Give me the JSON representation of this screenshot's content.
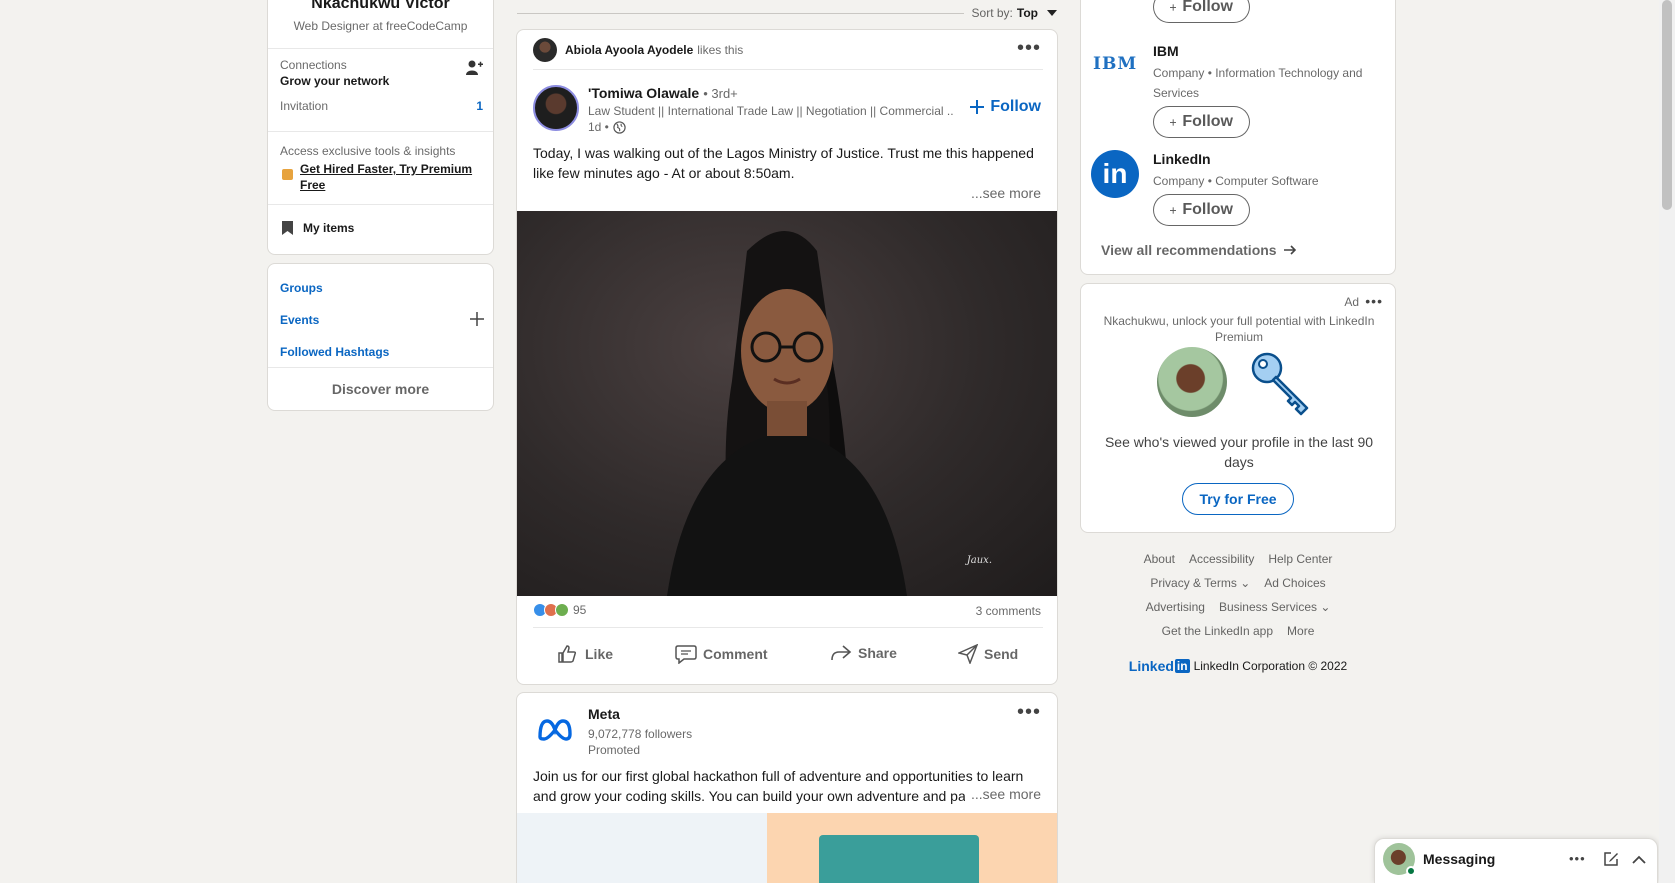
{
  "left": {
    "profile": {
      "name": "Nkachukwu Victor",
      "headline": "Web Designer at freeCodeCamp"
    },
    "connections": {
      "label": "Connections",
      "sub": "Grow your network"
    },
    "invitation": {
      "label": "Invitation",
      "count": "1"
    },
    "premium": {
      "teaser": "Access exclusive tools & insights",
      "link": "Get Hired Faster, Try Premium Free"
    },
    "my_items": "My items",
    "links": {
      "groups": "Groups",
      "events": "Events",
      "hashtags": "Followed Hashtags"
    },
    "discover": "Discover more"
  },
  "feed": {
    "sort_label": "Sort by:",
    "sort_value": "Top",
    "post1": {
      "liker": "Abiola Ayoola Ayodele",
      "likes_this": "likes this",
      "author": "'Tomiwa Olawale",
      "degree": "• 3rd+",
      "headline": "Law Student || International Trade Law || Negotiation || Commercial ...",
      "time": "1d •",
      "follow": "Follow",
      "text": "Today, I was walking out of the Lagos Ministry of Justice. Trust me this happened like few minutes ago - At or about 8:50am.",
      "see_more": "...see more",
      "watermark": "Jaux.",
      "reactions_count": "95",
      "comments": "3 comments",
      "actions": {
        "like": "Like",
        "comment": "Comment",
        "share": "Share",
        "send": "Send"
      }
    },
    "post2": {
      "company": "Meta",
      "followers": "9,072,778 followers",
      "promoted": "Promoted",
      "text": "Join us for our first global hackathon full of adventure and opportunities to learn and grow your coding skills. You can build your own adventure and pa",
      "see_more": "...see more"
    }
  },
  "right": {
    "follow_label": "Follow",
    "recs": [
      {
        "name": "IBM",
        "desc": "Company • Information Technology and Services"
      },
      {
        "name": "LinkedIn",
        "desc": "Company • Computer Software"
      }
    ],
    "view_all": "View all recommendations",
    "ad": {
      "tag": "Ad",
      "teaser": "Nkachukwu, unlock your full potential with LinkedIn Premium",
      "headline": "See who's viewed your profile in the last 90 days",
      "cta": "Try for Free"
    },
    "footer": {
      "row1": [
        "About",
        "Accessibility",
        "Help Center"
      ],
      "privacy": "Privacy & Terms",
      "ad_choices": "Ad Choices",
      "advertising": "Advertising",
      "business": "Business Services",
      "get_app": "Get the LinkedIn app",
      "more": "More",
      "brand_text": "Linked",
      "brand_in": "in",
      "copyright": "LinkedIn Corporation © 2022"
    }
  },
  "messaging": {
    "label": "Messaging"
  },
  "colors": {
    "accent": "#0a66c2",
    "background": "#f3f2ef",
    "online": "#057642"
  }
}
